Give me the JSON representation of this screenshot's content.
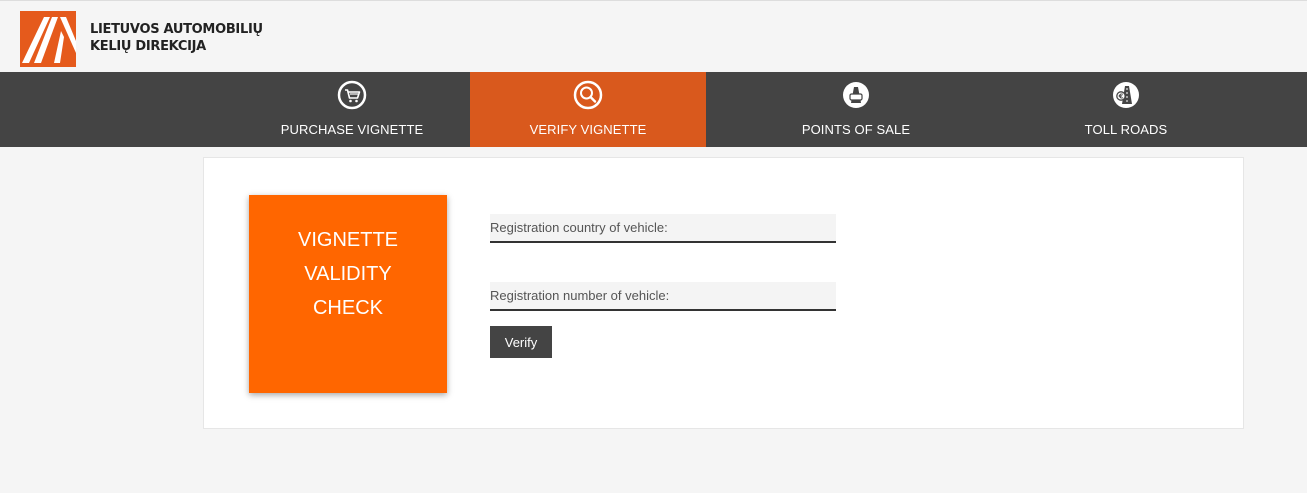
{
  "brand": {
    "line1": "LIETUVOS AUTOMOBILIŲ",
    "line2": "KELIŲ DIREKCIJA",
    "accent_color": "#e55a1c"
  },
  "nav": {
    "items": [
      {
        "label": "PURCHASE VIGNETTE",
        "icon": "shopping-cart-icon",
        "active": false
      },
      {
        "label": "VERIFY VIGNETTE",
        "icon": "magnifier-icon",
        "active": true
      },
      {
        "label": "POINTS OF SALE",
        "icon": "road-car-icon",
        "active": false
      },
      {
        "label": "TOLL ROADS",
        "icon": "euro-road-icon",
        "active": false
      }
    ],
    "background_color": "#444444",
    "active_color": "#d9591d"
  },
  "promo": {
    "line1": "VIGNETTE",
    "line2": "VALIDITY",
    "line3": "CHECK",
    "color": "#ff6600"
  },
  "form": {
    "country_placeholder": "Registration country of vehicle:",
    "number_placeholder": "Registration number of vehicle:",
    "verify_label": "Verify"
  }
}
